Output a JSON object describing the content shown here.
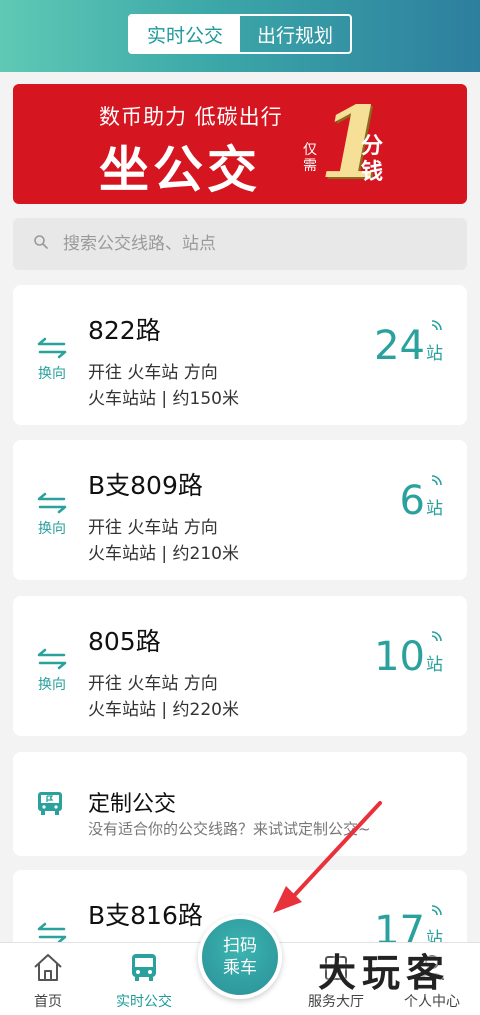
{
  "header": {
    "tabs": [
      {
        "label": "实时公交",
        "active": true
      },
      {
        "label": "出行规划",
        "active": false
      }
    ]
  },
  "banner": {
    "slogan": "数币助力 低碳出行",
    "headline": "坐公交",
    "only": "仅需",
    "amount": "1",
    "unit": "分钱"
  },
  "search": {
    "placeholder": "搜索公交线路、站点"
  },
  "routes": [
    {
      "name": "822路",
      "direction": "开往 火车站 方向",
      "station": "火车站站 | 约150米",
      "stops": "24",
      "stops_unit": "站",
      "swap_label": "换向"
    },
    {
      "name": "B支809路",
      "direction": "开往 火车站 方向",
      "station": "火车站站 | 约210米",
      "stops": "6",
      "stops_unit": "站",
      "swap_label": "换向"
    },
    {
      "name": "805路",
      "direction": "开往 火车站 方向",
      "station": "火车站站 | 约220米",
      "stops": "10",
      "stops_unit": "站",
      "swap_label": "换向"
    },
    {
      "name": "B支816路",
      "stops": "17",
      "stops_unit": "站"
    }
  ],
  "custom": {
    "title": "定制公交",
    "subtitle": "没有适合你的公交线路？来试试定制公交~"
  },
  "nav": {
    "items": [
      {
        "label": "首页",
        "icon": "home-icon"
      },
      {
        "label": "实时公交",
        "icon": "bus-icon"
      },
      {
        "label": "服务大厅",
        "icon": "service-icon"
      },
      {
        "label": "个人中心",
        "icon": "user-icon"
      }
    ],
    "scan": [
      "扫码",
      "乘车"
    ]
  },
  "watermark": "大玩客",
  "colors": {
    "accent": "#2aa19d",
    "banner_red": "#d5151f",
    "gold": "#f6df96"
  }
}
